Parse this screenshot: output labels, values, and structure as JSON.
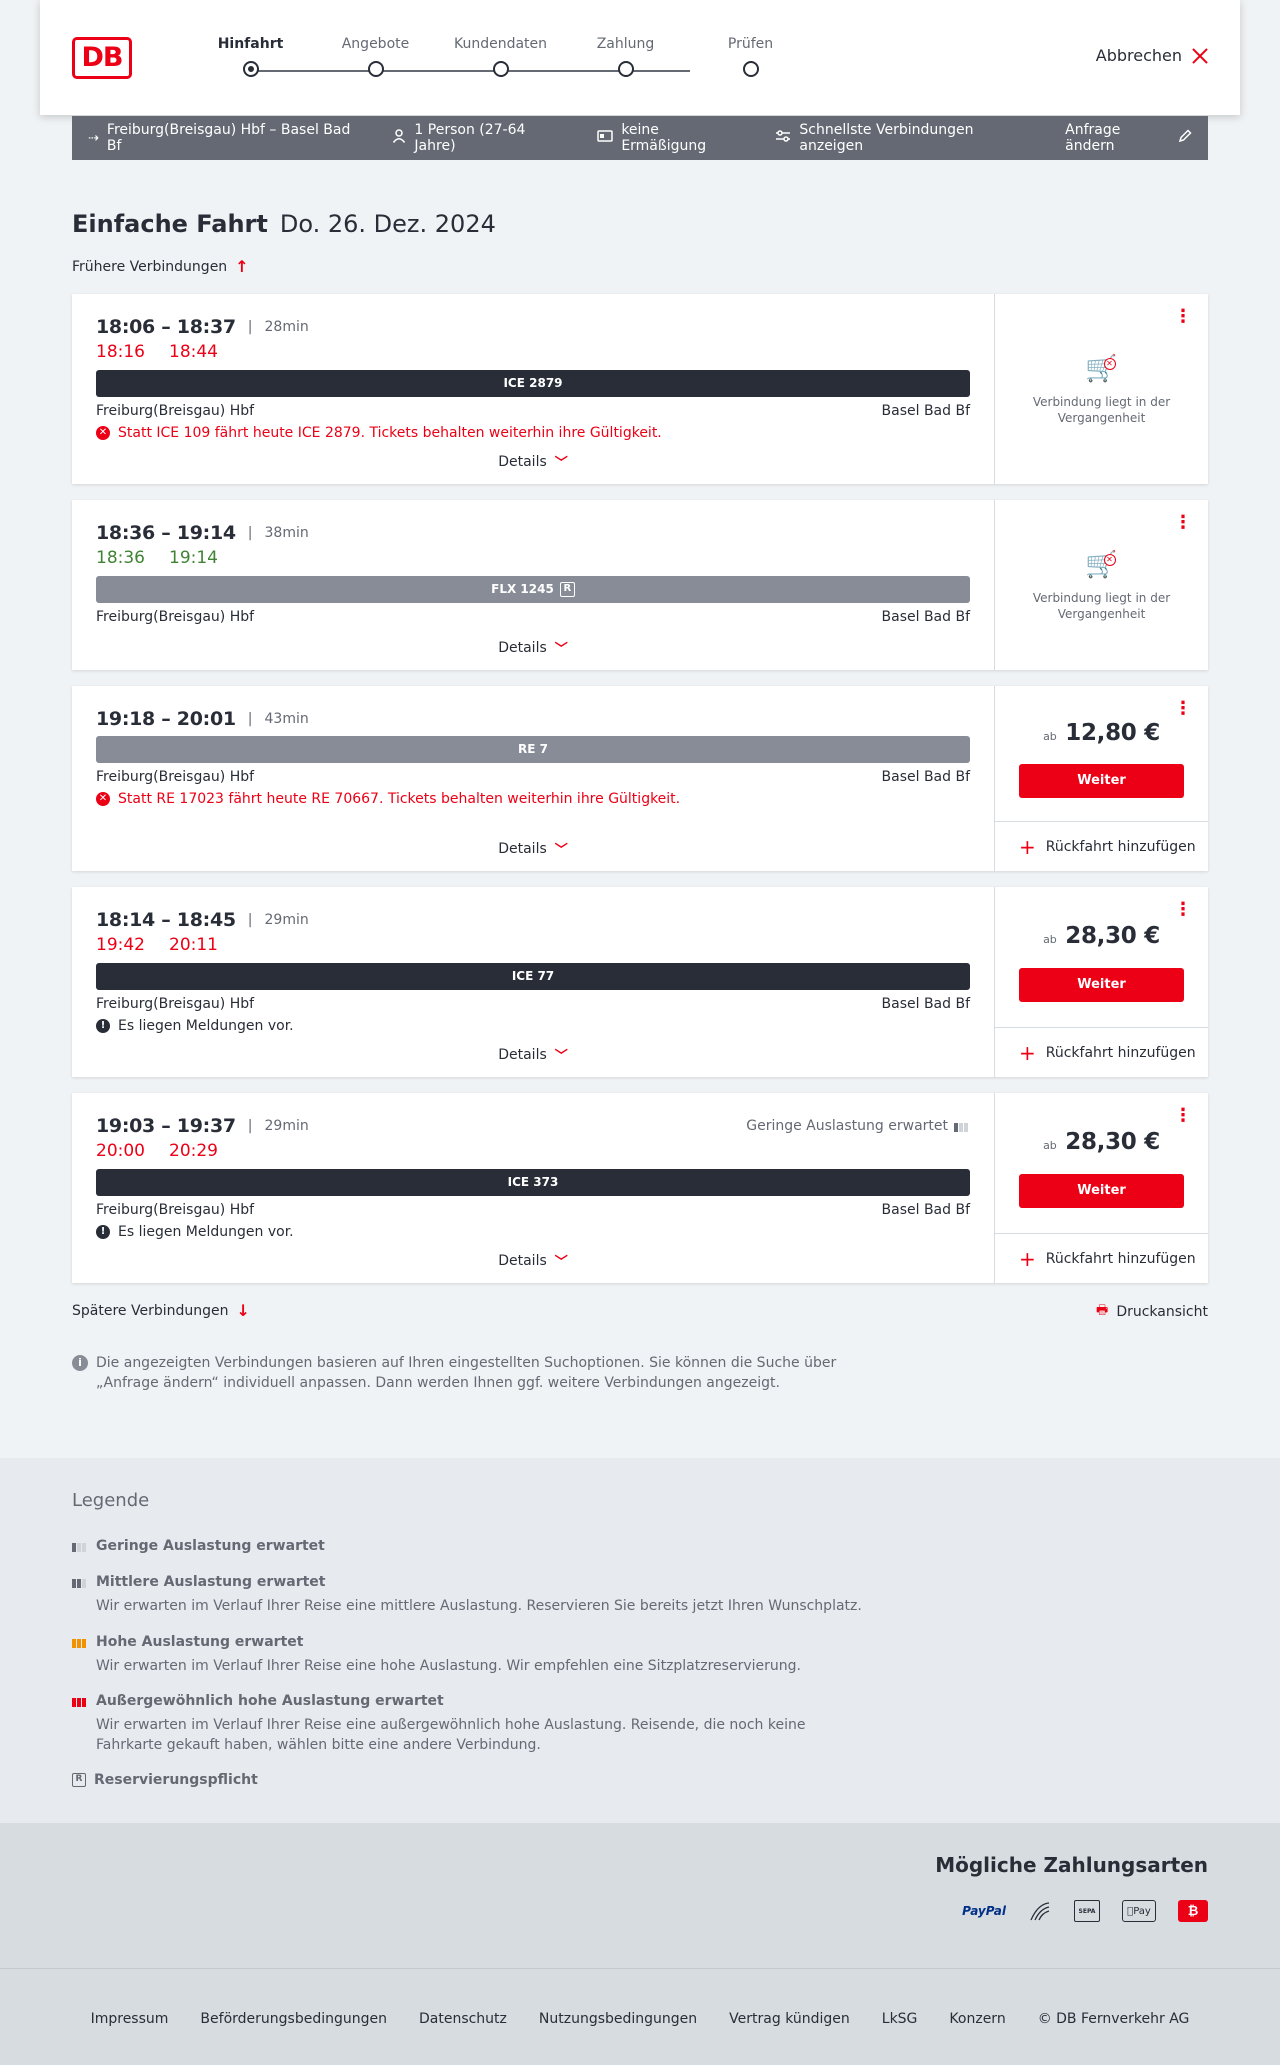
{
  "header": {
    "steps": [
      "Hinfahrt",
      "Angebote",
      "Kundendaten",
      "Zahlung",
      "Prüfen"
    ],
    "cancel_label": "Abbrechen",
    "logo_text": "DB"
  },
  "request": {
    "route": "Freiburg(Breisgau) Hbf – Basel Bad Bf",
    "persons": "1 Person (27-64 Jahre)",
    "discount": "keine Ermäßigung",
    "fastest": "Schnellste Verbindungen anzeigen",
    "change": "Anfrage ändern"
  },
  "page": {
    "title": "Einfache Fahrt",
    "date": "Do. 26. Dez. 2024",
    "earlier": "Frühere Verbindungen",
    "later": "Spätere Verbindungen",
    "print": "Druckansicht",
    "info": "Die angezeigten Verbindungen basieren auf Ihren eingestellten Suchoptionen. Sie können die Suche über „Anfrage ändern“ individuell anpassen. Dann werden Ihnen ggf. weitere Verbindungen angezeigt."
  },
  "common": {
    "details": "Details",
    "past": "Verbindung liegt in der Vergangenheit",
    "ab": "ab",
    "weiter": "Weiter",
    "return": "Rückfahrt hinzufügen"
  },
  "connections": [
    {
      "times": "18:06 – 18:37",
      "duration": "28min",
      "rt_dep": "18:16",
      "rt_arr": "18:44",
      "train": "ICE 2879",
      "from": "Freiburg(Breisgau) Hbf",
      "to": "Basel Bad Bf",
      "message": "Statt ICE 109 fährt heute ICE 2879. Tickets behalten weiterhin ihre Gültigkeit."
    },
    {
      "times": "18:36 – 19:14",
      "duration": "38min",
      "rt_dep": "18:36",
      "rt_arr": "19:14",
      "train": "FLX 1245",
      "train_badge": "R",
      "from": "Freiburg(Breisgau) Hbf",
      "to": "Basel Bad Bf"
    },
    {
      "times": "19:18 – 20:01",
      "duration": "43min",
      "train": "RE 7",
      "from": "Freiburg(Breisgau) Hbf",
      "to": "Basel Bad Bf",
      "message": "Statt RE 17023 fährt heute RE 70667. Tickets behalten weiterhin ihre Gültigkeit.",
      "price": "12,80 €"
    },
    {
      "times": "18:14 – 18:45",
      "duration": "29min",
      "rt_dep": "19:42",
      "rt_arr": "20:11",
      "train": "ICE 77",
      "from": "Freiburg(Breisgau) Hbf",
      "to": "Basel Bad Bf",
      "message": "Es liegen Meldungen vor.",
      "price": "28,30 €"
    },
    {
      "times": "19:03 – 19:37",
      "duration": "29min",
      "rt_dep": "20:00",
      "rt_arr": "20:29",
      "load": "Geringe Auslastung erwartet",
      "train": "ICE 373",
      "from": "Freiburg(Breisgau) Hbf",
      "to": "Basel Bad Bf",
      "message": "Es liegen Meldungen vor.",
      "price": "28,30 €"
    }
  ],
  "legend": {
    "title": "Legende",
    "items": [
      {
        "title": "Geringe Auslastung erwartet",
        "desc": ""
      },
      {
        "title": "Mittlere Auslastung erwartet",
        "desc": "Wir erwarten im Verlauf Ihrer Reise eine mittlere Auslastung. Reservieren Sie bereits jetzt Ihren Wunschplatz."
      },
      {
        "title": "Hohe Auslastung erwartet",
        "desc": "Wir erwarten im Verlauf Ihrer Reise eine hohe Auslastung. Wir empfehlen eine Sitzplatzreservierung."
      },
      {
        "title": "Außergewöhnlich hohe Auslastung erwartet",
        "desc": "Wir erwarten im Verlauf Ihrer Reise eine außergewöhnlich hohe Auslastung. Reisende, die noch keine Fahrkarte gekauft haben, wählen bitte eine andere Verbindung."
      },
      {
        "title": "Reservierungspflicht",
        "desc": ""
      }
    ],
    "colors": {
      "low": "#646973",
      "mid": "#646973",
      "high": "#f39200",
      "extreme": "#ec0016"
    }
  },
  "payment": {
    "title": "Mögliche Zahlungsarten",
    "methods": [
      "PayPal",
      "SEPA",
      "Pay"
    ]
  },
  "footer": {
    "links": [
      "Impressum",
      "Beförderungsbedingungen",
      "Datenschutz",
      "Nutzungsbedingungen",
      "Vertrag kündigen",
      "LkSG",
      "Konzern",
      "© DB Fernverkehr AG"
    ]
  },
  "colors": {
    "accent": "#ec0016",
    "dark": "#282d37",
    "grey": "#646973",
    "ontime": "#408335"
  }
}
